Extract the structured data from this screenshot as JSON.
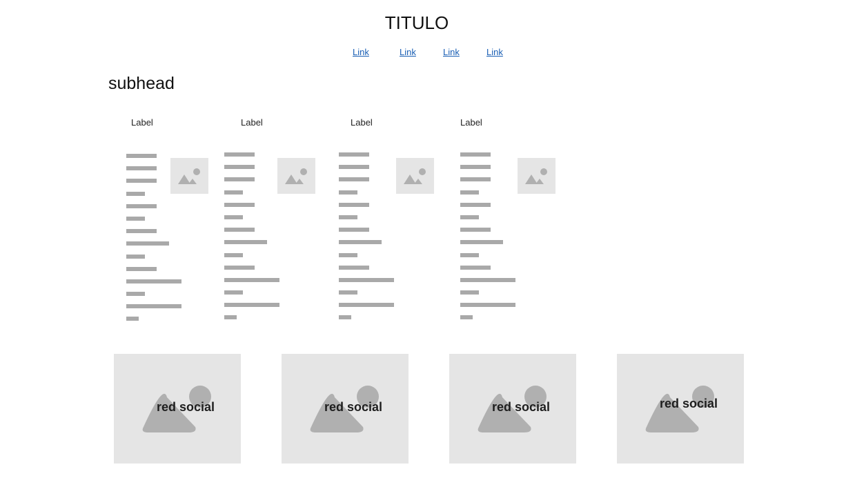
{
  "header": {
    "title": "TITULO",
    "links": [
      "Link",
      "Link",
      "Link",
      "Link"
    ]
  },
  "subhead": "subhead",
  "columns": [
    {
      "label": "Label",
      "image_icon": "image-placeholder-icon"
    },
    {
      "label": "Label",
      "image_icon": "image-placeholder-icon"
    },
    {
      "label": "Label",
      "image_icon": "image-placeholder-icon"
    },
    {
      "label": "Label",
      "image_icon": "image-placeholder-icon"
    }
  ],
  "social_cards": [
    {
      "label": "red social",
      "image_icon": "image-placeholder-icon"
    },
    {
      "label": "red social",
      "image_icon": "image-placeholder-icon"
    },
    {
      "label": "red social",
      "image_icon": "image-placeholder-icon"
    },
    {
      "label": "red social",
      "image_icon": "image-placeholder-icon"
    }
  ],
  "colors": {
    "link": "#1a5fb4",
    "placeholder_bg": "#e5e5e5",
    "placeholder_fg": "#b0b0b0",
    "text_line": "#a9a9a9"
  }
}
